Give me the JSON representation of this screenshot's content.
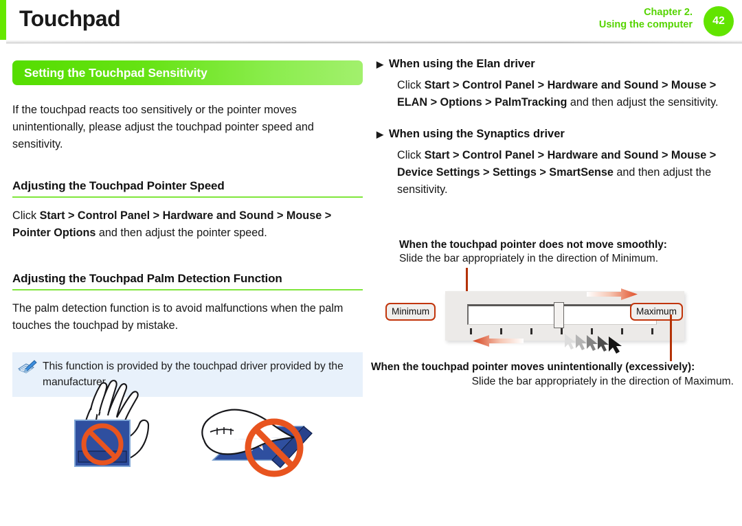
{
  "header": {
    "title": "Touchpad",
    "chapter_line1": "Chapter 2.",
    "chapter_line2": "Using the computer",
    "page_number": "42",
    "accent_green": "#62e400",
    "bar_green": "#66e800"
  },
  "left_column": {
    "section_bar_title": "Setting the Touchpad Sensitivity",
    "intro_paragraph": "If the touchpad reacts too sensitively or the pointer moves unintentionally, please adjust the touchpad pointer speed and sensitivity.",
    "pointer_speed": {
      "heading": "Adjusting the Touchpad Pointer Speed",
      "paragraph_parts": [
        {
          "text": "Click ",
          "bold": false
        },
        {
          "text": "Start > Control Panel > Hardware and Sound > Mouse > Pointer Options",
          "bold": true
        },
        {
          "text": " and then adjust the pointer speed.",
          "bold": false
        }
      ]
    },
    "palm_detection": {
      "heading": "Adjusting the Touchpad Palm Detection Function",
      "paragraph": "The palm detection function is to avoid malfunctions when the palm touches the touchpad by mistake."
    },
    "note": {
      "icon": "note-pencil-icon",
      "text": "This function is provided by the touchpad driver provided by the manufacturer.",
      "background": "#e8f1fb"
    },
    "illustrations": {
      "left_caption": "palm-resting-on-touchpad-prohibited",
      "right_caption": "hand-tapping-touchpad-prohibited",
      "prohibition_color": "#e8541f",
      "touchpad_color": "#2b4a9c"
    }
  },
  "right_column": {
    "elan": {
      "bullet": "▶",
      "heading": "When using the Elan driver",
      "paragraph_parts": [
        {
          "text": "Click ",
          "bold": false
        },
        {
          "text": "Start > Control Panel > Hardware and Sound > Mouse > ELAN > Options > PalmTracking",
          "bold": true
        },
        {
          "text": " and then adjust the sensitivity.",
          "bold": false
        }
      ]
    },
    "synaptics": {
      "bullet": "▶",
      "heading": "When using the Synaptics driver",
      "paragraph_parts": [
        {
          "text": "Click ",
          "bold": false
        },
        {
          "text": "Start > Control Panel > Hardware and Sound > Mouse > Device Settings > Settings > SmartSense",
          "bold": true
        },
        {
          "text": " and then adjust the sensitivity.",
          "bold": false
        }
      ]
    },
    "diagram": {
      "caption_top_bold": "When the touchpad pointer does not move smoothly:",
      "caption_top_normal": "Slide the bar appropriately in the direction of Minimum.",
      "caption_bottom_bold": "When the touchpad pointer moves unintentionally (excessively):",
      "caption_bottom_normal": "Slide the bar appropriately in the direction of Maximum.",
      "label_minimum": "Minimum",
      "label_maximum": "Maximum",
      "slider_thumb_position_percent": 46,
      "tick_count": 7,
      "leader_line_color": "#b43205",
      "label_border_color": "#c1340a",
      "arrow_color": "#e0502a",
      "panel_background": "#eceae8"
    }
  }
}
